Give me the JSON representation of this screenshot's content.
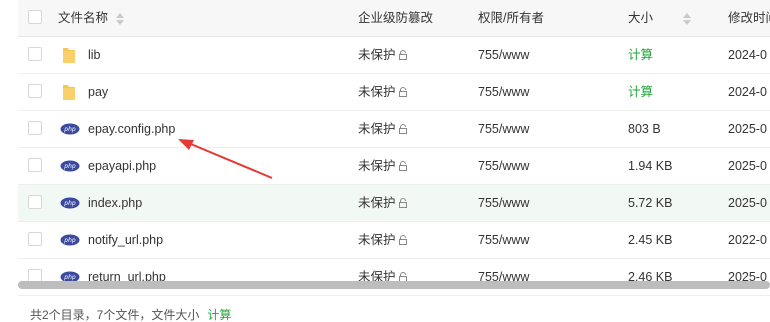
{
  "headers": {
    "name": "文件名称",
    "protect": "企业级防篡改",
    "perm": "权限/所有者",
    "size": "大小",
    "time": "修改时间"
  },
  "rows": [
    {
      "name": "lib",
      "type": "folder",
      "protect": "未保护",
      "perm": "755/www",
      "size": "计算",
      "time": "2024-0"
    },
    {
      "name": "pay",
      "type": "folder",
      "protect": "未保护",
      "perm": "755/www",
      "size": "计算",
      "time": "2024-0"
    },
    {
      "name": "epay.config.php",
      "type": "php",
      "protect": "未保护",
      "perm": "755/www",
      "size": "803 B",
      "time": "2025-0"
    },
    {
      "name": "epayapi.php",
      "type": "php",
      "protect": "未保护",
      "perm": "755/www",
      "size": "1.94 KB",
      "time": "2025-0"
    },
    {
      "name": "index.php",
      "type": "php",
      "protect": "未保护",
      "perm": "755/www",
      "size": "5.72 KB",
      "time": "2025-0"
    },
    {
      "name": "notify_url.php",
      "type": "php",
      "protect": "未保护",
      "perm": "755/www",
      "size": "2.45 KB",
      "time": "2022-0"
    },
    {
      "name": "return_url.php",
      "type": "php",
      "protect": "未保护",
      "perm": "755/www",
      "size": "2.46 KB",
      "time": "2025-0"
    }
  ],
  "footer": {
    "summary": "共2个目录，7个文件，文件大小",
    "calc": "计算"
  },
  "colors": {
    "accent_green": "#20a53a",
    "highlight_row": "#f2f8f4",
    "arrow_red": "#e53935",
    "php_icon": "#3b4aa0"
  },
  "icons": {
    "folder": "folder-icon",
    "php": "php-file-icon",
    "lock": "lock-icon"
  }
}
